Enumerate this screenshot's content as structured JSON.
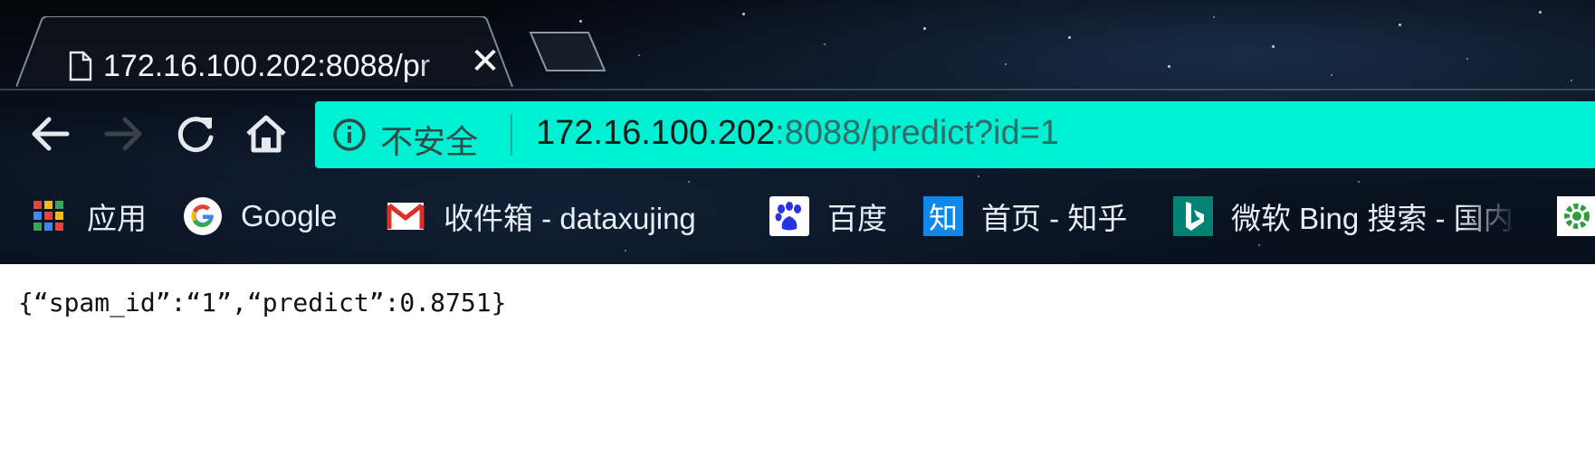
{
  "tab": {
    "title": "172.16.100.202:8088/pr",
    "close_glyph": "✕",
    "favicon": "page-icon"
  },
  "toolbar": {
    "back_icon": "back-arrow-icon",
    "forward_icon": "forward-arrow-icon",
    "reload_icon": "reload-icon",
    "home_icon": "home-icon"
  },
  "omnibox": {
    "security_label": "不安全",
    "url_host": "172.16.100.202",
    "url_rest": ":8088/predict?id=1",
    "accent": "#00f0d4"
  },
  "bookmarks": [
    {
      "label": "应用",
      "icon": "apps-grid-icon"
    },
    {
      "label": "Google",
      "icon": "google-icon"
    },
    {
      "label": "收件箱 - dataxujing",
      "icon": "gmail-icon"
    },
    {
      "label": "百度",
      "icon": "baidu-icon"
    },
    {
      "label": "首页 - 知乎",
      "icon": "zhihu-icon"
    },
    {
      "label": "微软 Bing 搜索 - 国内",
      "icon": "bing-icon"
    }
  ],
  "bookmark_icon_glyphs": {
    "zhihu": "知"
  },
  "page": {
    "body_text": "{“spam_id”:“1”,“predict”:0.8751}"
  }
}
